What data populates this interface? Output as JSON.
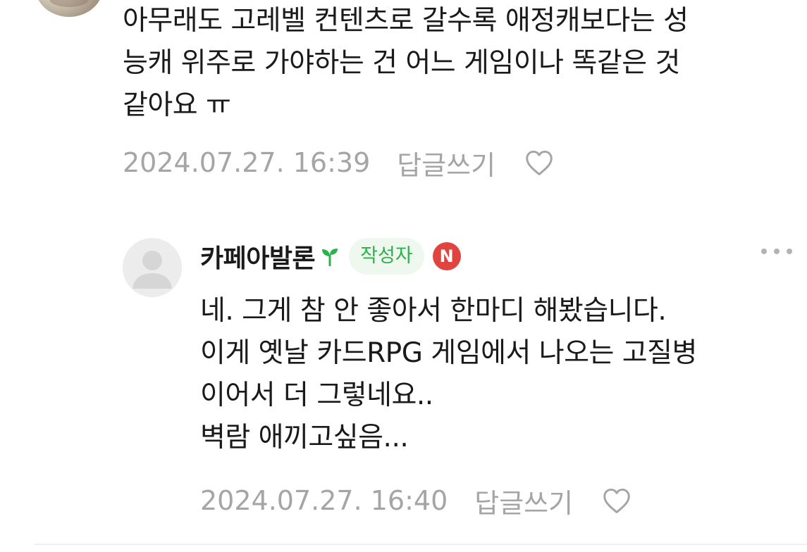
{
  "top_comment": {
    "lines": [
      "아무래도 고레벨 컨텐츠로 갈수록 애정캐보다는 성",
      "능캐 위주로 가야하는 건 어느 게임이나 똑같은 것",
      "같아요 ㅠ"
    ],
    "timestamp": "2024.07.27. 16:39",
    "reply_label": "답글쓰기"
  },
  "reply_comment": {
    "nickname": "카페아발론",
    "author_badge": "작성자",
    "n_badge": "N",
    "lines": [
      "네. 그게 참 안 좋아서 한마디 해봤습니다.",
      "이게 옛날 카드RPG 게임에서 나오는 고질병",
      "이어서 더 그렇네요..",
      "벽람 애끼고싶음..."
    ],
    "timestamp": "2024.07.27. 16:40",
    "reply_label": "답글쓰기"
  },
  "icons": {
    "heart": "heart-outline-icon",
    "sprout": "sprout-icon",
    "more": "more-horizontal-icon"
  },
  "colors": {
    "text": "#1a1a1a",
    "meta": "#a5a5a5",
    "badge_green": "#2bb24c",
    "badge_bg": "#eef8ee",
    "new_badge": "#e0443e"
  }
}
